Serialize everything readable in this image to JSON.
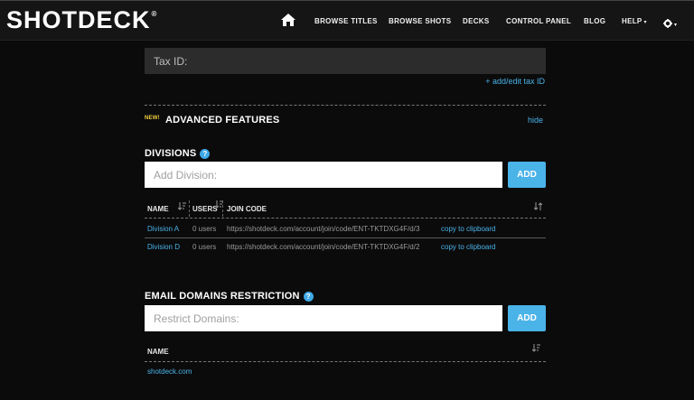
{
  "brand": {
    "logo_text": "SHOTDECK",
    "registered_mark": "®"
  },
  "nav": {
    "home_icon": "home-icon",
    "items": [
      "BROWSE TITLES",
      "BROWSE SHOTS",
      "DECKS",
      "CONTROL PANEL",
      "BLOG",
      "HELP"
    ],
    "help_caret": "▾",
    "settings_icon": "gear-icon",
    "settings_caret": "▾"
  },
  "tax": {
    "placeholder": "Tax ID:",
    "edit_link": "+ add/edit tax ID"
  },
  "advanced": {
    "badge": "NEW!",
    "title": "ADVANCED FEATURES",
    "hide_link": "hide"
  },
  "divisions": {
    "title": "DIVISIONS",
    "help": "?",
    "input_placeholder": "Add Division:",
    "add_label": "ADD",
    "columns": {
      "name": "NAME",
      "users": "USERS",
      "join_code": "JOIN CODE"
    },
    "rows": [
      {
        "name": "Division A",
        "users": "0 users",
        "join_code": "https://shotdeck.com/account/join/code/ENT-TKTDXG4F/d/3",
        "copy": "copy to clipboard"
      },
      {
        "name": "Division D",
        "users": "0 users",
        "join_code": "https://shotdeck.com/account/join/code/ENT-TKTDXG4F/d/2",
        "copy": "copy to clipboard"
      }
    ]
  },
  "email_domains": {
    "title": "EMAIL DOMAINS RESTRICTION",
    "help": "?",
    "input_placeholder": "Restrict Domains:",
    "add_label": "ADD",
    "columns": {
      "name": "NAME"
    },
    "rows": [
      {
        "name": "shotdeck.com"
      }
    ]
  },
  "colors": {
    "accent": "#4ab3e8",
    "badge": "#f4d03f",
    "background": "#0b0b0c",
    "topbar": "#151515"
  }
}
